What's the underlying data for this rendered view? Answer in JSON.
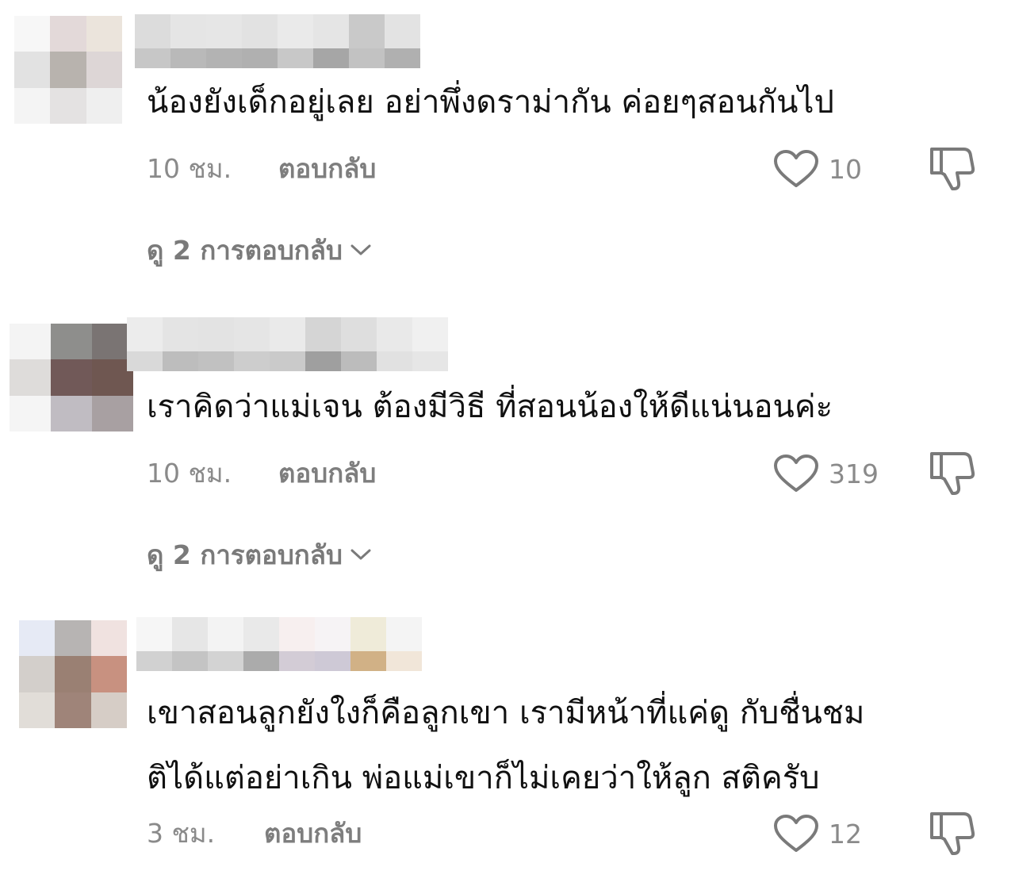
{
  "comments": [
    {
      "text_lines": [
        "น้องยังเด็กอยู่เลย อย่าพึ่งดราม่ากัน ค่อยๆสอนกันไป"
      ],
      "time": "10 ชม.",
      "reply_label": "ตอบกลับ",
      "likes": "10",
      "view_replies": "ดู 2 การตอบกลับ",
      "avatar_colors": [
        "#f7f7f7",
        "#e3d9d9",
        "#ebe4dc",
        "#e2e2e2",
        "#b8b3ae",
        "#ddd6d6",
        "#f4f4f4",
        "#e4e2e2",
        "#efefef"
      ],
      "username_colors": [
        [
          "#dcdcdc",
          "#c7c7c7"
        ],
        [
          "#e5e5e5",
          "#b9b9b9"
        ],
        [
          "#e6e6e6",
          "#b3b3b3"
        ],
        [
          "#e2e2e2",
          "#b0b0b0"
        ],
        [
          "#eaeaea",
          "#c8c8c8"
        ],
        [
          "#e5e5e5",
          "#a6a6a6"
        ],
        [
          "#c9c9c9",
          "#c2c2c2"
        ],
        [
          "#e3e3e3",
          "#b0b0b0"
        ]
      ]
    },
    {
      "text_lines": [
        "เราคิดว่าแม่เจน ต้องมีวิธี ที่สอนน้องให้ดีแน่นอนค่ะ"
      ],
      "time": "10 ชม.",
      "reply_label": "ตอบกลับ",
      "likes": "319",
      "view_replies": "ดู 2 การตอบกลับ",
      "avatar_colors": [
        "#f4f4f4",
        "#8e8e8c",
        "#7a7473",
        "#dedcda",
        "#715958",
        "#6f5751",
        "#f5f5f5",
        "#c0bcc2",
        "#a8a0a2"
      ],
      "username_colors": [
        [
          "#ececec",
          "#d9d9d9"
        ],
        [
          "#e4e4e4",
          "#bdbdbd"
        ],
        [
          "#e3e3e3",
          "#c1c1c1"
        ],
        [
          "#e5e5e5",
          "#cdcdcd"
        ],
        [
          "#eaeaea",
          "#cacaca"
        ],
        [
          "#d5d5d5",
          "#9f9f9f"
        ],
        [
          "#dedede",
          "#bcbcbc"
        ],
        [
          "#e9e9e9",
          "#e1e1e1"
        ],
        [
          "#f0f0f0",
          "#e6e6e6"
        ]
      ]
    },
    {
      "text_lines": [
        "เขาสอนลูกยังใงก็คือลูกเขา เรามีหน้าที่แค่ดู กับชื่นชม",
        "ติได้แต่อย่าเกิน พ่อแม่เขาก็ไม่เคยว่าให้ลูก สติครับ"
      ],
      "time": "3 ชม.",
      "reply_label": "ตอบกลับ",
      "likes": "12",
      "avatar_colors": [
        "#e6eaf5",
        "#b7b4b3",
        "#f0e2e0",
        "#d3cfcb",
        "#9a8073",
        "#c89180",
        "#e1ddd8",
        "#9f8479",
        "#d6cdc6"
      ],
      "username_colors": [
        [
          "#f6f6f6",
          "#d1d1d1"
        ],
        [
          "#e6e6e6",
          "#c4c4c4"
        ],
        [
          "#f3f3f3",
          "#d3d3d3"
        ],
        [
          "#e9e9e9",
          "#ababab"
        ],
        [
          "#f7efef",
          "#d3ccd6"
        ],
        [
          "#f6f3f5",
          "#cec9d6"
        ],
        [
          "#efebd9",
          "#d1b186"
        ],
        [
          "#f4f4f4",
          "#f1e6d9"
        ]
      ]
    }
  ]
}
